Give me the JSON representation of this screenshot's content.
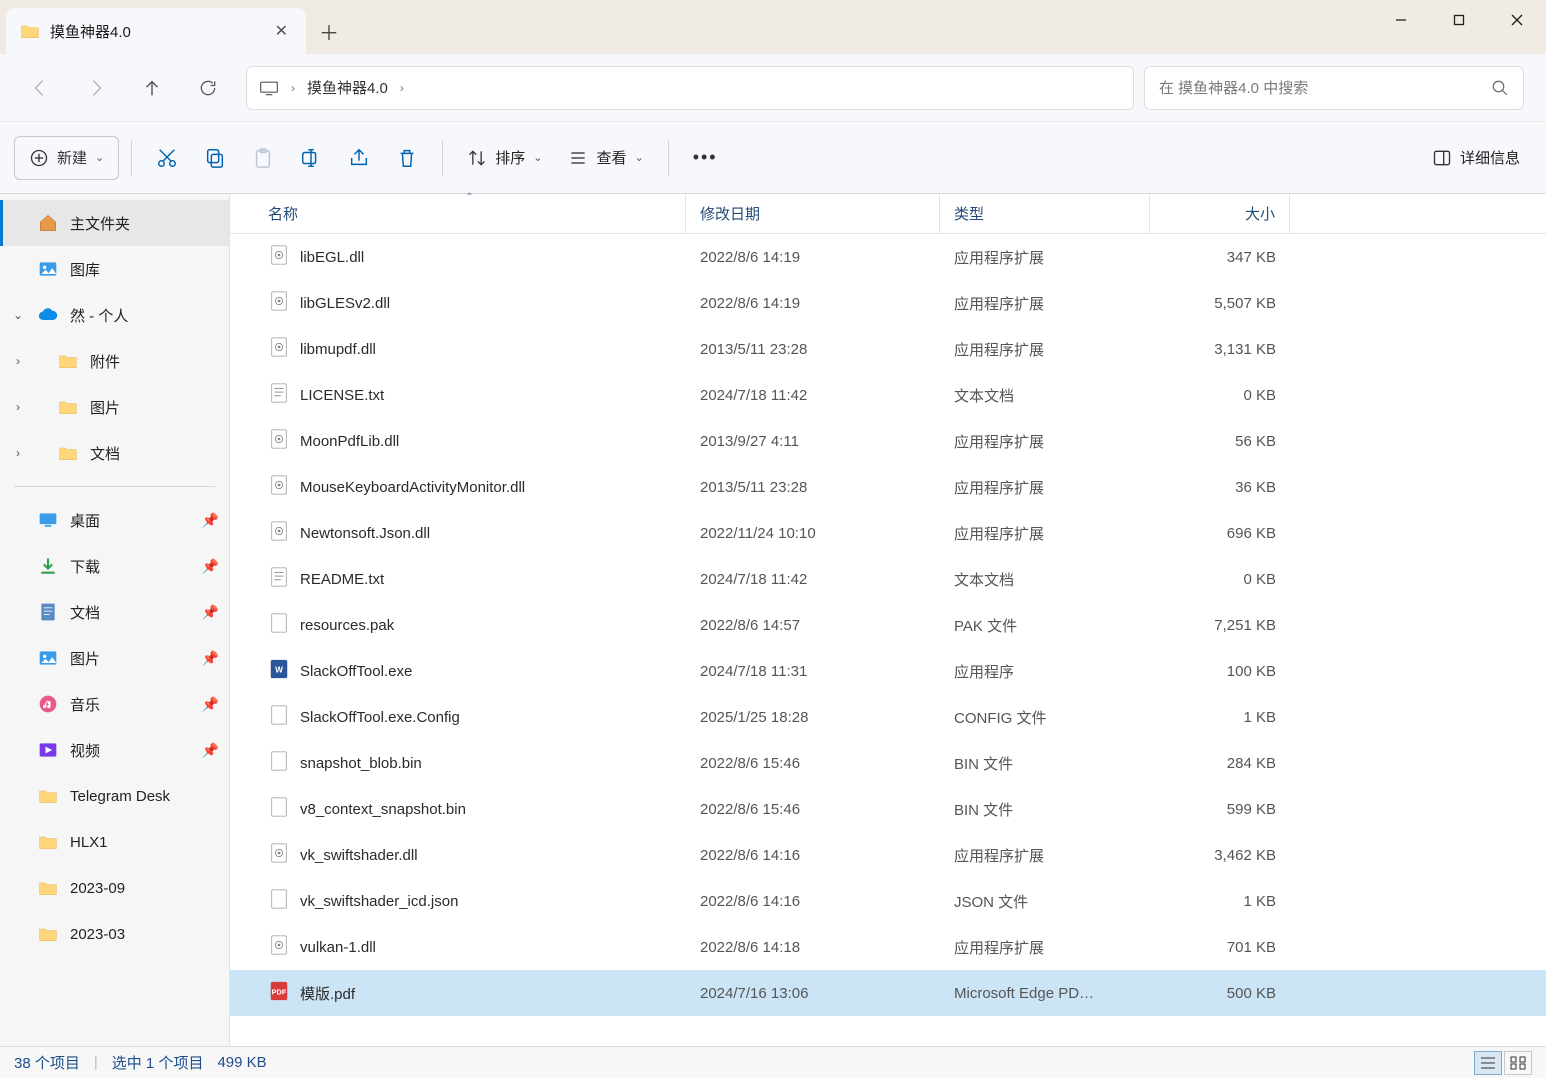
{
  "tab": {
    "title": "摸鱼神器4.0"
  },
  "address": {
    "current": "摸鱼神器4.0"
  },
  "search": {
    "placeholder": "在 摸鱼神器4.0 中搜索"
  },
  "toolbar": {
    "new": "新建",
    "sort": "排序",
    "view": "查看",
    "details": "详细信息"
  },
  "sidebar": {
    "home": "主文件夹",
    "gallery": "图库",
    "onedrive": "然 - 个人",
    "od_children": [
      "附件",
      "图片",
      "文档"
    ],
    "quick": [
      {
        "label": "桌面",
        "pin": true,
        "color": "#3a9be8"
      },
      {
        "label": "下载",
        "pin": true,
        "color": "#2e9e4a"
      },
      {
        "label": "文档",
        "pin": true,
        "color": "#5a8bc4"
      },
      {
        "label": "图片",
        "pin": true,
        "color": "#3a9be8"
      },
      {
        "label": "音乐",
        "pin": true,
        "color": "#e85a8a"
      },
      {
        "label": "视频",
        "pin": true,
        "color": "#7a3ae8"
      },
      {
        "label": "Telegram Desk",
        "pin": false
      },
      {
        "label": "HLX1",
        "pin": false
      },
      {
        "label": "2023-09",
        "pin": false
      },
      {
        "label": "2023-03",
        "pin": false
      }
    ]
  },
  "columns": {
    "name": "名称",
    "date": "修改日期",
    "type": "类型",
    "size": "大小"
  },
  "files": [
    {
      "name": "libEGL.dll",
      "date": "2022/8/6 14:19",
      "type": "应用程序扩展",
      "size": "347 KB",
      "icon": "dll"
    },
    {
      "name": "libGLESv2.dll",
      "date": "2022/8/6 14:19",
      "type": "应用程序扩展",
      "size": "5,507 KB",
      "icon": "dll"
    },
    {
      "name": "libmupdf.dll",
      "date": "2013/5/11 23:28",
      "type": "应用程序扩展",
      "size": "3,131 KB",
      "icon": "dll"
    },
    {
      "name": "LICENSE.txt",
      "date": "2024/7/18 11:42",
      "type": "文本文档",
      "size": "0 KB",
      "icon": "txt"
    },
    {
      "name": "MoonPdfLib.dll",
      "date": "2013/9/27 4:11",
      "type": "应用程序扩展",
      "size": "56 KB",
      "icon": "dll"
    },
    {
      "name": "MouseKeyboardActivityMonitor.dll",
      "date": "2013/5/11 23:28",
      "type": "应用程序扩展",
      "size": "36 KB",
      "icon": "dll"
    },
    {
      "name": "Newtonsoft.Json.dll",
      "date": "2022/11/24 10:10",
      "type": "应用程序扩展",
      "size": "696 KB",
      "icon": "dll"
    },
    {
      "name": "README.txt",
      "date": "2024/7/18 11:42",
      "type": "文本文档",
      "size": "0 KB",
      "icon": "txt"
    },
    {
      "name": "resources.pak",
      "date": "2022/8/6 14:57",
      "type": "PAK 文件",
      "size": "7,251 KB",
      "icon": "file"
    },
    {
      "name": "SlackOffTool.exe",
      "date": "2024/7/18 11:31",
      "type": "应用程序",
      "size": "100 KB",
      "icon": "exe"
    },
    {
      "name": "SlackOffTool.exe.Config",
      "date": "2025/1/25 18:28",
      "type": "CONFIG 文件",
      "size": "1 KB",
      "icon": "file"
    },
    {
      "name": "snapshot_blob.bin",
      "date": "2022/8/6 15:46",
      "type": "BIN 文件",
      "size": "284 KB",
      "icon": "file"
    },
    {
      "name": "v8_context_snapshot.bin",
      "date": "2022/8/6 15:46",
      "type": "BIN 文件",
      "size": "599 KB",
      "icon": "file"
    },
    {
      "name": "vk_swiftshader.dll",
      "date": "2022/8/6 14:16",
      "type": "应用程序扩展",
      "size": "3,462 KB",
      "icon": "dll"
    },
    {
      "name": "vk_swiftshader_icd.json",
      "date": "2022/8/6 14:16",
      "type": "JSON 文件",
      "size": "1 KB",
      "icon": "file"
    },
    {
      "name": "vulkan-1.dll",
      "date": "2022/8/6 14:18",
      "type": "应用程序扩展",
      "size": "701 KB",
      "icon": "dll"
    },
    {
      "name": "模版.pdf",
      "date": "2024/7/16 13:06",
      "type": "Microsoft Edge PD…",
      "size": "500 KB",
      "icon": "pdf",
      "selected": true
    }
  ],
  "status": {
    "items": "38 个项目",
    "selected": "选中 1 个项目",
    "size": "499 KB"
  }
}
